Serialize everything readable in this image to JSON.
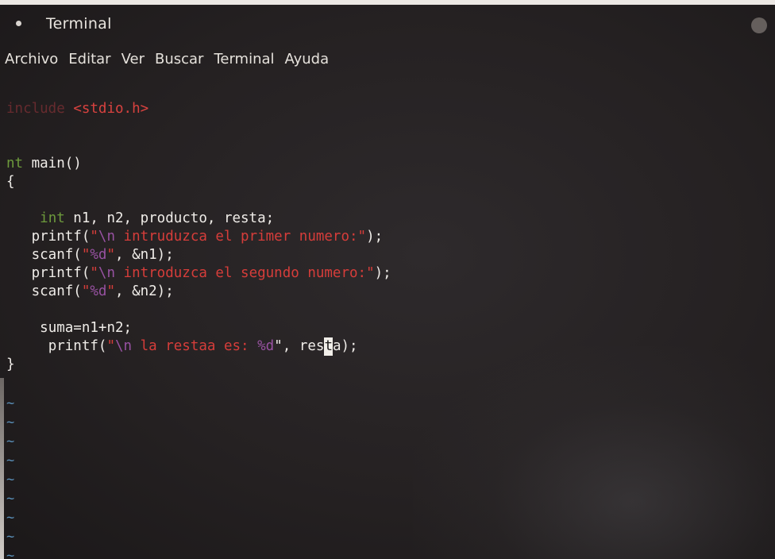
{
  "window": {
    "title": "Terminal"
  },
  "menu": [
    "Archivo",
    "Editar",
    "Ver",
    "Buscar",
    "Terminal",
    "Ayuda"
  ],
  "code": {
    "include_keyword": "include",
    "include_header": "<stdio.h>",
    "main_type": "nt",
    "main_sig": " main()",
    "open_brace": "{",
    "decl_type": "int",
    "decl_rest": " n1, n2, producto, resta;",
    "l1_a": "printf(",
    "l1_q1": "\"",
    "l1_esc": "\\n",
    "l1_str": " intruduzca el primer numero:",
    "l1_q2": "\"",
    "l1_end": ");",
    "l2_a": "scanf(",
    "l2_q1": "\"",
    "l2_fmt": "%d",
    "l2_q2": "\"",
    "l2_end": ", &n1);",
    "l3_a": "printf(",
    "l3_q1": "\"",
    "l3_esc": "\\n",
    "l3_str": " introduzca el segundo numero:",
    "l3_q2": "\"",
    "l3_end": ");",
    "l4_a": "scanf(",
    "l4_q1": "\"",
    "l4_fmt": "%d",
    "l4_q2": "\"",
    "l4_end": ", &n2);",
    "l5": "suma=n1+n2;",
    "l6_a": "printf(",
    "l6_q1": "\"",
    "l6_esc": "\\n",
    "l6_str": " la restaa es: ",
    "l6_fmt": "%d",
    "l6_q2": "\"",
    "l6_mid": ", res",
    "l6_cursor": "t",
    "l6_end": "a);",
    "close_brace": "}"
  },
  "empty_line_marker": "~\n~\n~\n~\n~\n~\n~\n~\n~"
}
